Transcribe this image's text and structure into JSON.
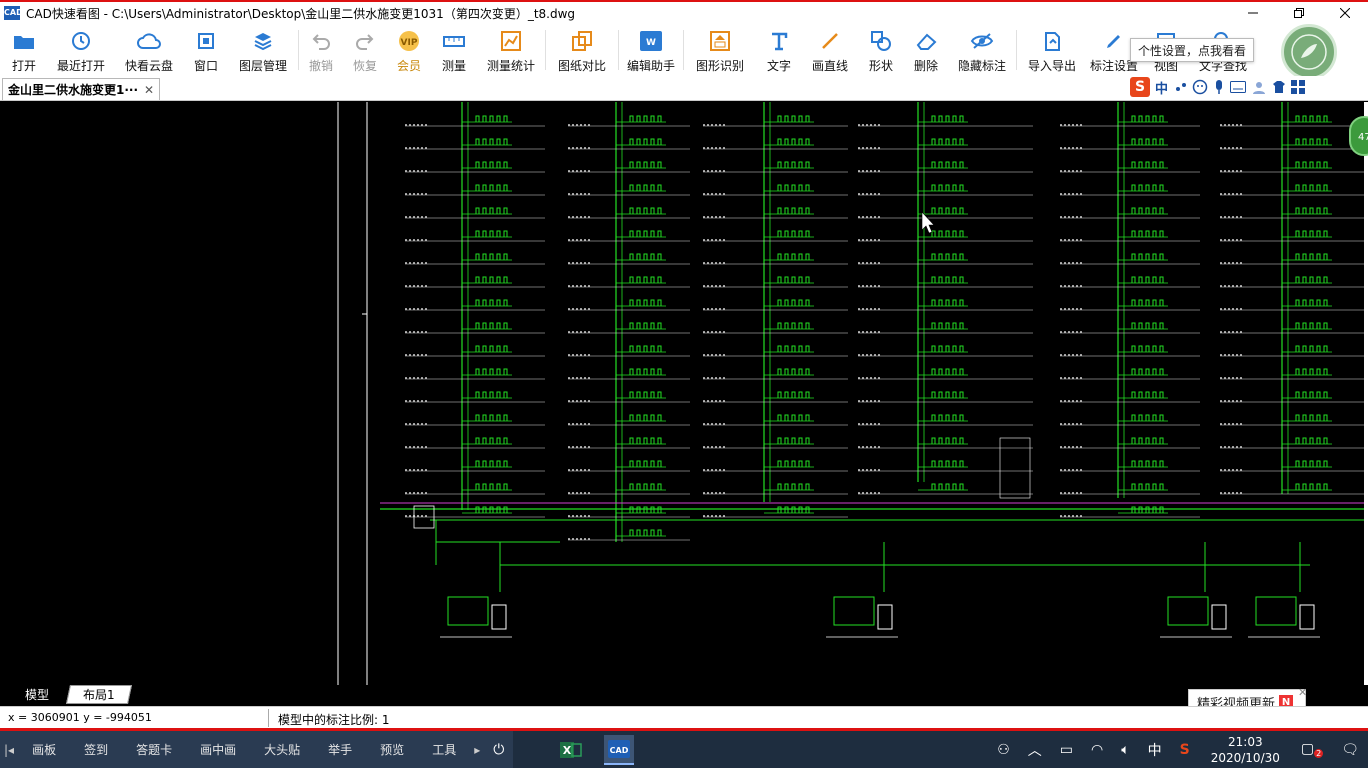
{
  "window": {
    "app_icon_text": "CAD",
    "title": "CAD快速看图 - C:\\Users\\Administrator\\Desktop\\金山里二供水施变更1031（第四次变更）_t8.dwg"
  },
  "toolbar": {
    "items": [
      {
        "label": "打开",
        "icon": "folder-open-icon",
        "state": "enabled"
      },
      {
        "label": "最近打开",
        "icon": "clock-history-icon",
        "state": "enabled"
      },
      {
        "label": "快看云盘",
        "icon": "cloud-icon",
        "state": "enabled"
      },
      {
        "label": "窗口",
        "icon": "window-frame-icon",
        "state": "enabled"
      },
      {
        "label": "图层管理",
        "icon": "layers-icon",
        "state": "enabled"
      },
      {
        "label": "撤销",
        "icon": "undo-icon",
        "state": "disabled"
      },
      {
        "label": "恢复",
        "icon": "redo-icon",
        "state": "disabled"
      },
      {
        "label": "会员",
        "icon": "vip-icon",
        "state": "vip"
      },
      {
        "label": "测量",
        "icon": "ruler-icon",
        "state": "enabled"
      },
      {
        "label": "测量统计",
        "icon": "measure-stats-icon",
        "state": "enabled"
      },
      {
        "label": "图纸对比",
        "icon": "compare-icon",
        "state": "enabled"
      },
      {
        "label": "编辑助手",
        "icon": "edit-assistant-icon",
        "state": "enabled"
      },
      {
        "label": "图形识别",
        "icon": "shape-recognize-icon",
        "state": "enabled"
      },
      {
        "label": "文字",
        "icon": "text-icon",
        "state": "enabled"
      },
      {
        "label": "画直线",
        "icon": "line-icon",
        "state": "enabled"
      },
      {
        "label": "形状",
        "icon": "shape-icon",
        "state": "enabled"
      },
      {
        "label": "删除",
        "icon": "eraser-icon",
        "state": "enabled"
      },
      {
        "label": "隐藏标注",
        "icon": "hide-eye-icon",
        "state": "enabled"
      },
      {
        "label": "导入导出",
        "icon": "import-export-icon",
        "state": "enabled"
      },
      {
        "label": "标注设置",
        "icon": "annotation-settings-icon",
        "state": "enabled"
      },
      {
        "label": "视图",
        "icon": "view-icon",
        "state": "enabled"
      },
      {
        "label": "文字查找",
        "icon": "text-search-icon",
        "state": "enabled"
      }
    ],
    "tooltip": "个性设置，点我看看",
    "accent_color": "#2b7bd3"
  },
  "tabs": {
    "document_tab": "金山里二供水施变更1···",
    "close_symbol": "✕"
  },
  "ime": {
    "logo": "S",
    "mode": "中"
  },
  "canvas": {
    "background": "#000000",
    "line_color": "#23e023",
    "page_badge": "47"
  },
  "sheet_tabs": {
    "model": "模型",
    "layout1": "布局1"
  },
  "notification": {
    "text": "精彩视频更新",
    "badge": "N"
  },
  "status": {
    "coordinates": "x = 3060901  y = -994051",
    "scale": "模型中的标注比例: 1"
  },
  "taskbar": {
    "quick_items": [
      "画板",
      "签到",
      "答题卡",
      "画中画",
      "大头贴",
      "举手",
      "预览",
      "工具"
    ],
    "time": "21:03",
    "date": "2020/10/30",
    "ime_indicator": "中",
    "notification_count": "2"
  }
}
